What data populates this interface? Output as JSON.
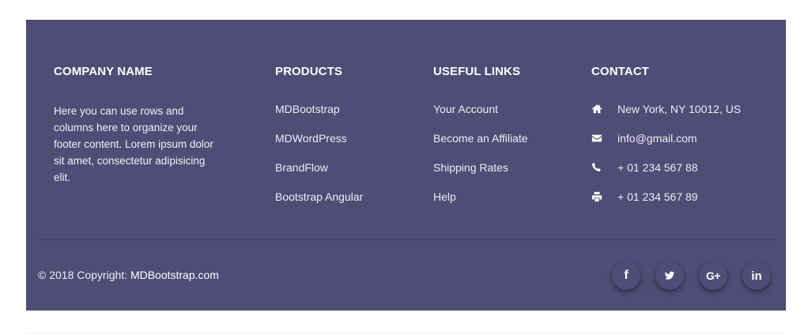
{
  "company": {
    "heading": "COMPANY NAME",
    "text": "Here you can use rows and columns here to organize your footer content. Lorem ipsum dolor sit amet, consectetur adipisicing elit."
  },
  "products": {
    "heading": "PRODUCTS",
    "items": [
      "MDBootstrap",
      "MDWordPress",
      "BrandFlow",
      "Bootstrap Angular"
    ]
  },
  "useful_links": {
    "heading": "USEFUL LINKS",
    "items": [
      "Your Account",
      "Become an Affiliate",
      "Shipping Rates",
      "Help"
    ]
  },
  "contact": {
    "heading": "CONTACT",
    "items": [
      {
        "icon": "home-icon",
        "text": "New York, NY 10012, US"
      },
      {
        "icon": "envelope-icon",
        "text": "info@gmail.com"
      },
      {
        "icon": "phone-icon",
        "text": "+ 01 234 567 88"
      },
      {
        "icon": "print-icon",
        "text": "+ 01 234 567 89"
      }
    ]
  },
  "footer_bottom": {
    "copyright_prefix": "© 2018 Copyright: ",
    "copyright_link": "MDBootstrap.com"
  },
  "social": {
    "facebook": "f",
    "twitter": "twitter-icon",
    "google_plus": "G+",
    "linkedin": "in"
  },
  "colors": {
    "footer_bg": "#4f4c76",
    "text": "#ffffff"
  }
}
